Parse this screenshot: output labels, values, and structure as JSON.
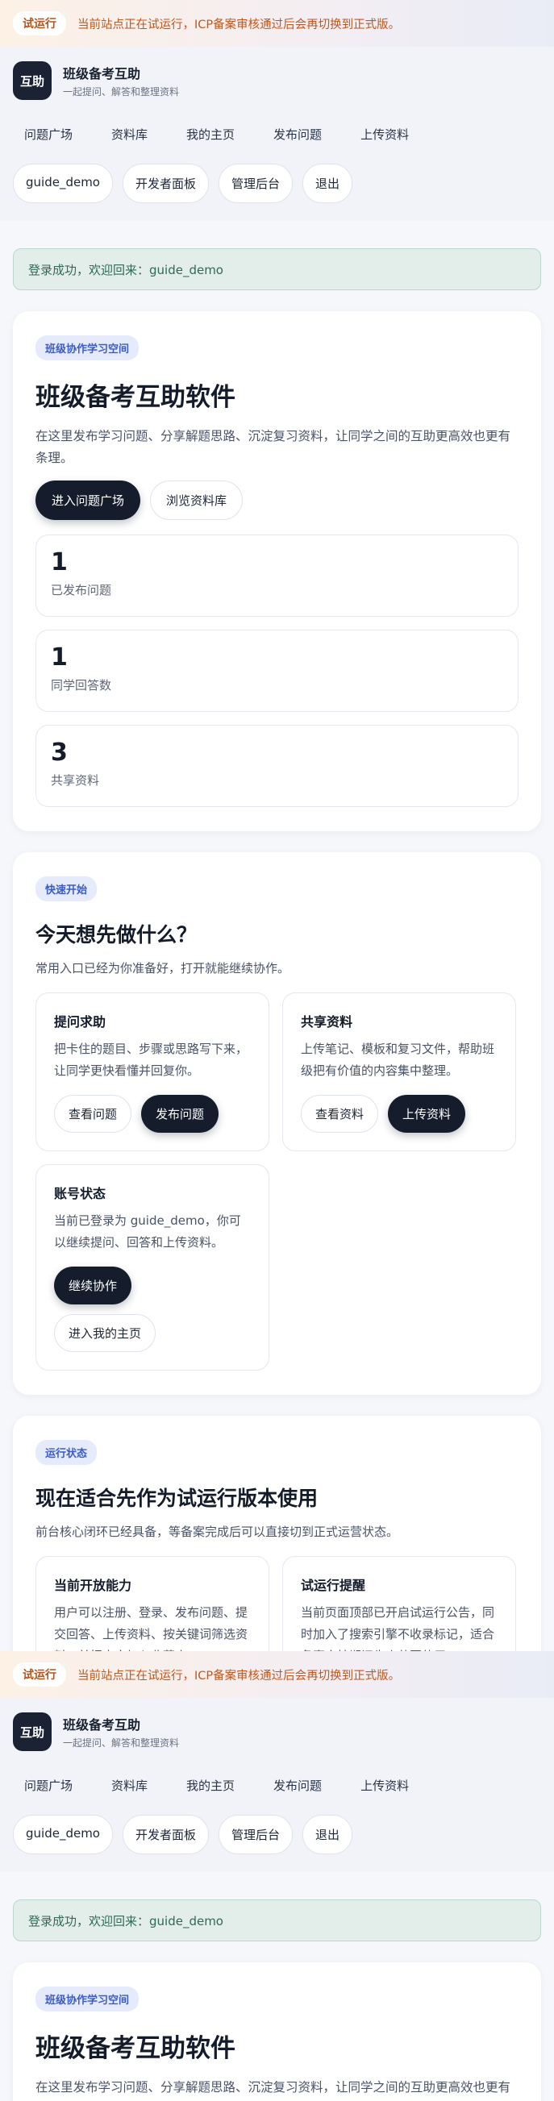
{
  "banner": {
    "badge": "试运行",
    "text": "当前站点正在试运行，ICP备案审核通过后会再切换到正式版。"
  },
  "brand": {
    "logo": "互助",
    "name": "班级备考互助",
    "subtitle": "一起提问、解答和整理资料"
  },
  "nav": {
    "items": [
      "问题广场",
      "资料库",
      "我的主页",
      "发布问题",
      "上传资料"
    ]
  },
  "user_actions": {
    "username": "guide_demo",
    "dev_panel": "开发者面板",
    "admin": "管理后台",
    "logout": "退出"
  },
  "alert": {
    "text": "登录成功，欢迎回来：guide_demo"
  },
  "hero": {
    "tag": "班级协作学习空间",
    "title": "班级备考互助软件",
    "desc": "在这里发布学习问题、分享解题思路、沉淀复习资料，让同学之间的互助更高效也更有条理。",
    "primary": "进入问题广场",
    "secondary": "浏览资料库",
    "stats": [
      {
        "value": "1",
        "label": "已发布问题"
      },
      {
        "value": "1",
        "label": "同学回答数"
      },
      {
        "value": "3",
        "label": "共享资料"
      }
    ]
  },
  "quick": {
    "tag": "快速开始",
    "title": "今天想先做什么？",
    "desc": "常用入口已经为你准备好，打开就能继续协作。",
    "cards": [
      {
        "title": "提问求助",
        "desc": "把卡住的题目、步骤或思路写下来，让同学更快看懂并回复你。",
        "btn_light": "查看问题",
        "btn_dark": "发布问题"
      },
      {
        "title": "共享资料",
        "desc": "上传笔记、模板和复习文件，帮助班级把有价值的内容集中整理。",
        "btn_light": "查看资料",
        "btn_dark": "上传资料"
      },
      {
        "title": "账号状态",
        "desc": "当前已登录为 guide_demo，你可以继续提问、回答和上传资料。",
        "btn_dark": "继续协作",
        "btn_light": "进入我的主页"
      }
    ]
  },
  "status": {
    "tag": "运行状态",
    "title": "现在适合先作为试运行版本使用",
    "desc": "前台核心闭环已经具备，等备案完成后可以直接切到正式运营状态。",
    "cards": [
      {
        "title": "当前开放能力",
        "desc": "用户可以注册、登录、发布问题、提交回答、上传资料、按关键词筛选资料，并把内容加入收藏夹。"
      },
      {
        "title": "试运行提醒",
        "desc": "当前页面顶部已开启试运行公告，同时加入了搜索引擎不收录标记，适合备案审核期间先小范围使用。"
      }
    ]
  }
}
